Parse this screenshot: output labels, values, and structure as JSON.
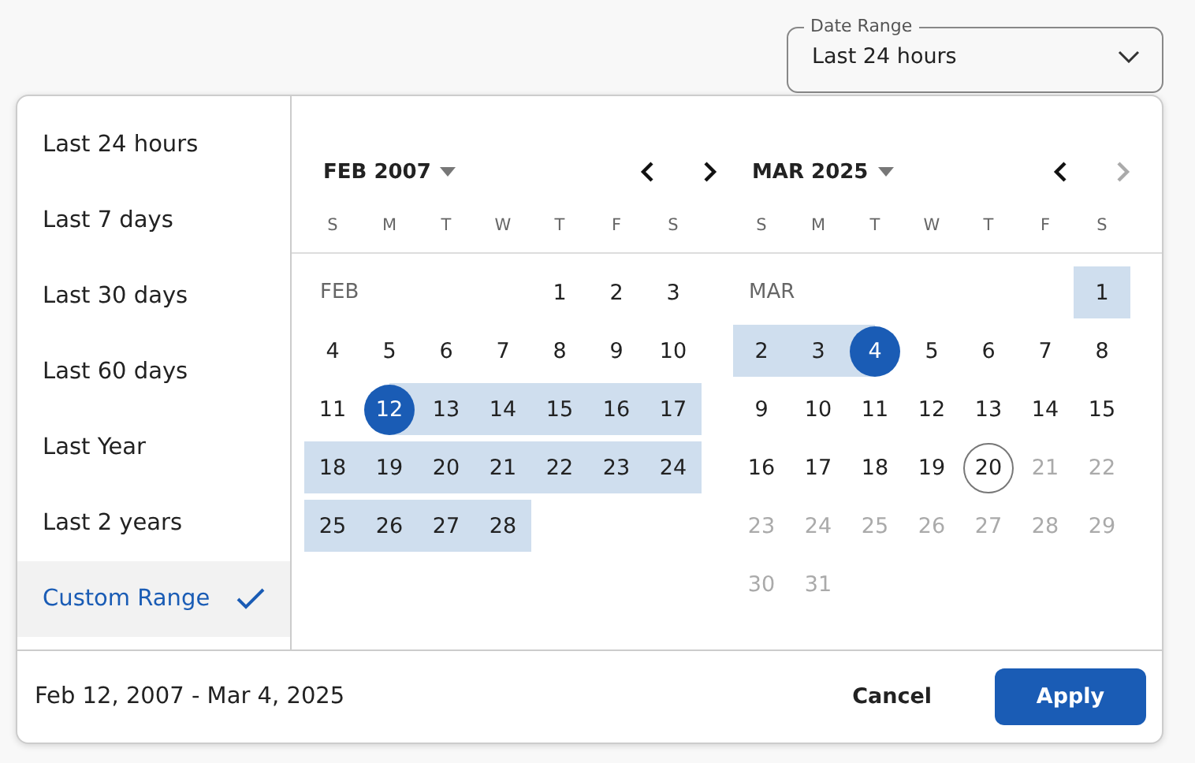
{
  "date_range_field": {
    "label": "Date Range",
    "value": "Last 24 hours"
  },
  "presets": [
    {
      "label": "Last 24 hours",
      "selected": false
    },
    {
      "label": "Last 7 days",
      "selected": false
    },
    {
      "label": "Last 30 days",
      "selected": false
    },
    {
      "label": "Last 60 days",
      "selected": false
    },
    {
      "label": "Last Year",
      "selected": false
    },
    {
      "label": "Last 2 years",
      "selected": false
    },
    {
      "label": "Custom Range",
      "selected": true
    }
  ],
  "months": [
    {
      "title": "FEB 2007",
      "prev_disabled": false,
      "next_disabled": false,
      "weekdays": [
        "S",
        "M",
        "T",
        "W",
        "T",
        "F",
        "S"
      ],
      "lead_label": "FEB",
      "weeks": [
        {
          "days": [
            {
              "label": "1",
              "kind": "normal"
            },
            {
              "label": "2",
              "kind": "normal"
            },
            {
              "label": "3",
              "kind": "normal"
            }
          ]
        },
        {
          "days": [
            {
              "label": "4",
              "kind": "normal"
            },
            {
              "label": "5",
              "kind": "normal"
            },
            {
              "label": "6",
              "kind": "normal"
            },
            {
              "label": "7",
              "kind": "normal"
            },
            {
              "label": "8",
              "kind": "normal"
            },
            {
              "label": "9",
              "kind": "normal"
            },
            {
              "label": "10",
              "kind": "normal"
            }
          ]
        },
        {
          "days": [
            {
              "label": "11",
              "kind": "normal"
            },
            {
              "label": "12",
              "kind": "start"
            },
            {
              "label": "13",
              "kind": "range"
            },
            {
              "label": "14",
              "kind": "range"
            },
            {
              "label": "15",
              "kind": "range"
            },
            {
              "label": "16",
              "kind": "range"
            },
            {
              "label": "17",
              "kind": "range"
            }
          ]
        },
        {
          "days": [
            {
              "label": "18",
              "kind": "range"
            },
            {
              "label": "19",
              "kind": "range"
            },
            {
              "label": "20",
              "kind": "range"
            },
            {
              "label": "21",
              "kind": "range"
            },
            {
              "label": "22",
              "kind": "range"
            },
            {
              "label": "23",
              "kind": "range"
            },
            {
              "label": "24",
              "kind": "range"
            }
          ]
        },
        {
          "days": [
            {
              "label": "25",
              "kind": "range"
            },
            {
              "label": "26",
              "kind": "range"
            },
            {
              "label": "27",
              "kind": "range"
            },
            {
              "label": "28",
              "kind": "range"
            }
          ]
        }
      ]
    },
    {
      "title": "MAR 2025",
      "prev_disabled": false,
      "next_disabled": true,
      "weekdays": [
        "S",
        "M",
        "T",
        "W",
        "T",
        "F",
        "S"
      ],
      "lead_label": "MAR",
      "weeks": [
        {
          "days": [
            {
              "label": "1",
              "kind": "range"
            }
          ]
        },
        {
          "days": [
            {
              "label": "2",
              "kind": "range"
            },
            {
              "label": "3",
              "kind": "range"
            },
            {
              "label": "4",
              "kind": "end"
            },
            {
              "label": "5",
              "kind": "normal"
            },
            {
              "label": "6",
              "kind": "normal"
            },
            {
              "label": "7",
              "kind": "normal"
            },
            {
              "label": "8",
              "kind": "normal"
            }
          ]
        },
        {
          "days": [
            {
              "label": "9",
              "kind": "normal"
            },
            {
              "label": "10",
              "kind": "normal"
            },
            {
              "label": "11",
              "kind": "normal"
            },
            {
              "label": "12",
              "kind": "normal"
            },
            {
              "label": "13",
              "kind": "normal"
            },
            {
              "label": "14",
              "kind": "normal"
            },
            {
              "label": "15",
              "kind": "normal"
            }
          ]
        },
        {
          "days": [
            {
              "label": "16",
              "kind": "normal"
            },
            {
              "label": "17",
              "kind": "normal"
            },
            {
              "label": "18",
              "kind": "normal"
            },
            {
              "label": "19",
              "kind": "normal"
            },
            {
              "label": "20",
              "kind": "today"
            },
            {
              "label": "21",
              "kind": "disabled"
            },
            {
              "label": "22",
              "kind": "disabled"
            }
          ]
        },
        {
          "days": [
            {
              "label": "23",
              "kind": "disabled"
            },
            {
              "label": "24",
              "kind": "disabled"
            },
            {
              "label": "25",
              "kind": "disabled"
            },
            {
              "label": "26",
              "kind": "disabled"
            },
            {
              "label": "27",
              "kind": "disabled"
            },
            {
              "label": "28",
              "kind": "disabled"
            },
            {
              "label": "29",
              "kind": "disabled"
            }
          ]
        },
        {
          "days": [
            {
              "label": "30",
              "kind": "disabled"
            },
            {
              "label": "31",
              "kind": "disabled"
            }
          ]
        }
      ]
    }
  ],
  "footer": {
    "range_text": "Feb 12, 2007 - Mar 4, 2025",
    "cancel": "Cancel",
    "apply": "Apply"
  }
}
